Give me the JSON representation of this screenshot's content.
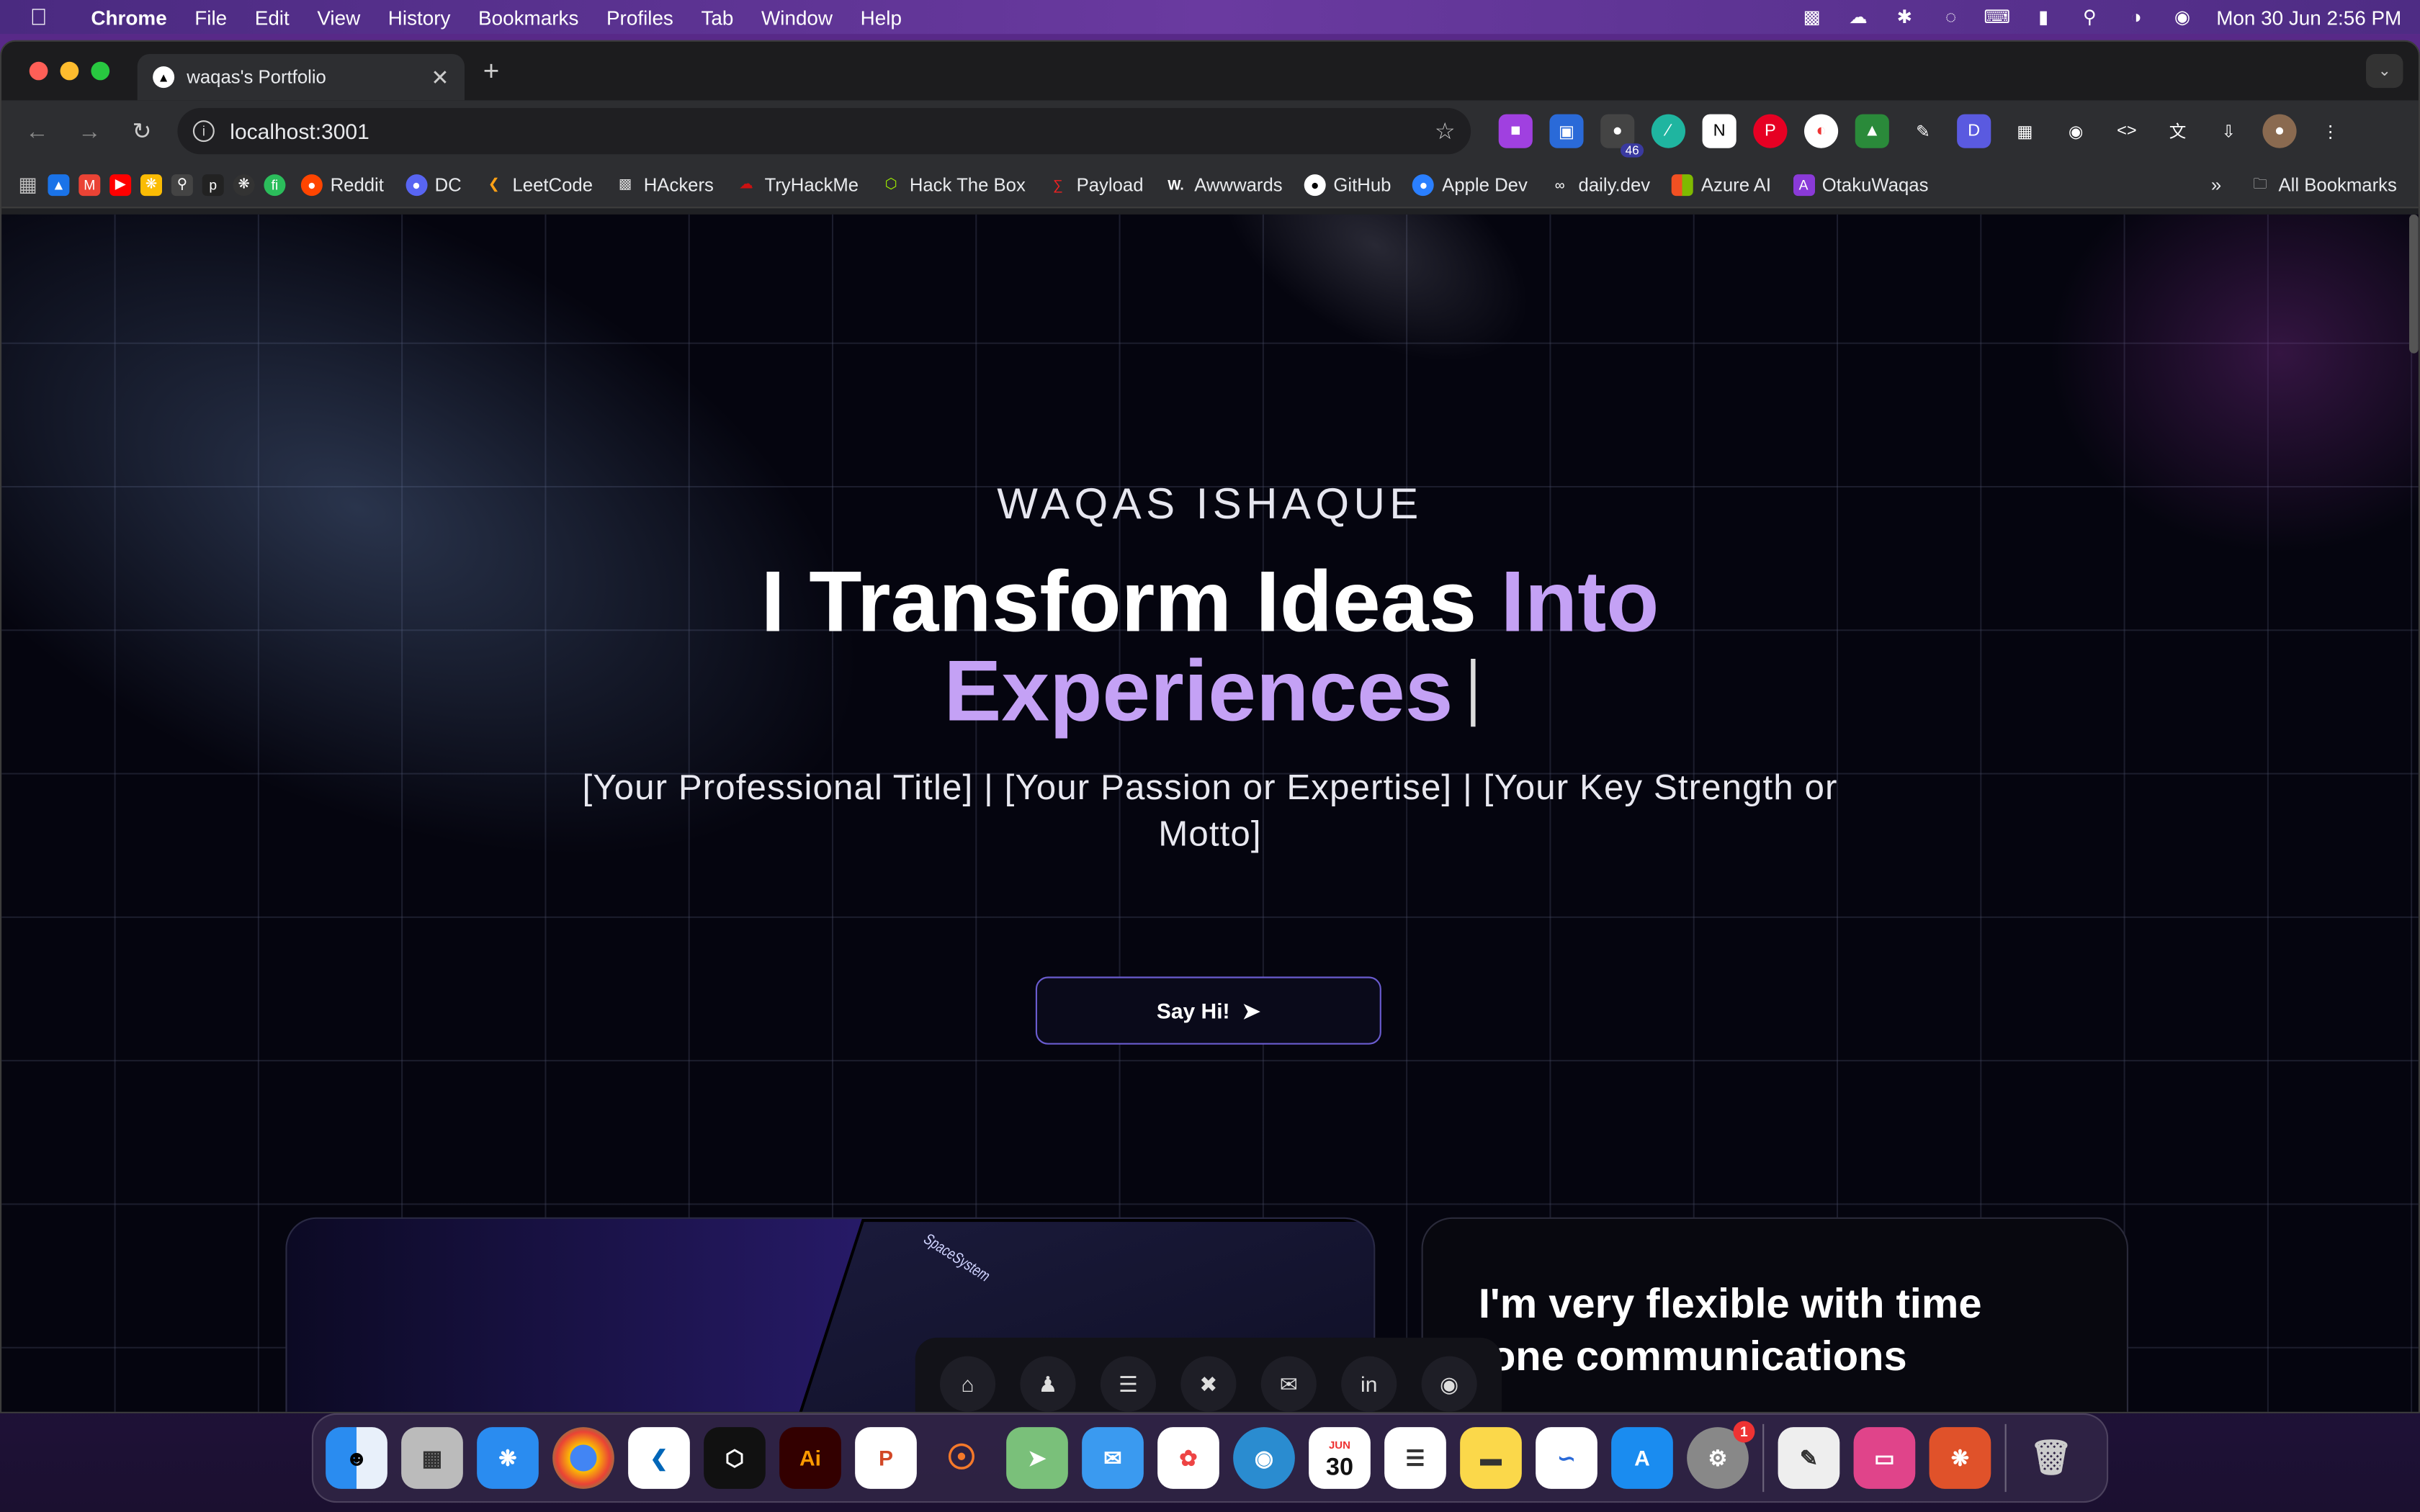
{
  "menubar": {
    "app": "Chrome",
    "items": [
      "File",
      "Edit",
      "View",
      "History",
      "Bookmarks",
      "Profiles",
      "Tab",
      "Window",
      "Help"
    ],
    "datetime": "Mon 30 Jun  2:56 PM"
  },
  "tab": {
    "title": "waqas's Portfolio"
  },
  "omnibox": {
    "url": "localhost:3001"
  },
  "extensions": {
    "badge_count": "46"
  },
  "bookmarks": {
    "items": [
      "Reddit",
      "DC",
      "LeetCode",
      "HAckers",
      "TryHackMe",
      "Hack The Box",
      "Payload",
      "Awwwards",
      "GitHub",
      "Apple Dev",
      "daily.dev",
      "Azure AI",
      "OtakuWaqas"
    ],
    "all_label": "All Bookmarks"
  },
  "hero": {
    "name": "WAQAS ISHAQUE",
    "headline_white": "I Transform Ideas ",
    "headline_purple_1": "Into",
    "headline_purple_2": "Experiences",
    "subtitle": "[Your Professional Title] | [Your Passion or Expertise] | [Your Key Strength or Motto]",
    "cta": "Say Hi!"
  },
  "cards": {
    "laptop_label": "SpaceSystem",
    "flex_text_1": "I'm very flexible with time",
    "flex_text_2": "one communications"
  },
  "dock": {
    "calendar_month": "JUN",
    "calendar_day": "30",
    "settings_badge": "1",
    "illustrator_label": "Ai"
  },
  "colors": {
    "accent": "#c4a1f5",
    "button_border": "#6a5ccf"
  }
}
